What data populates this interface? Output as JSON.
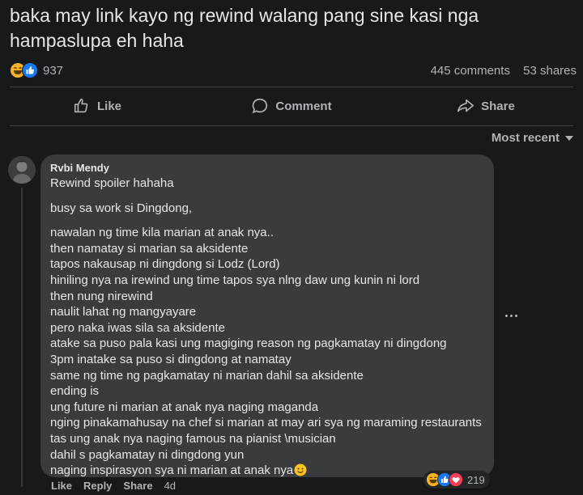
{
  "post": {
    "text": "baka may link kayo ng rewind walang pang sine kasi nga hampaslupa eh haha",
    "reaction_count": "937",
    "comments_count": "445 comments",
    "shares_count": "53 shares",
    "reaction_icons": [
      "haha-icon",
      "like-icon"
    ]
  },
  "actions": {
    "like": "Like",
    "comment": "Comment",
    "share": "Share"
  },
  "sort": {
    "label": "Most recent"
  },
  "comment": {
    "author": "Rvbi Mendy",
    "lines": [
      "Rewind spoiler hahaha",
      "busy sa work si Dingdong,",
      "nawalan ng time kila marian at anak nya..",
      "then namatay si marian sa aksidente",
      "tapos nakausap ni dingdong si Lodz (Lord)",
      "hiniling nya na irewind ung time tapos sya nlng daw ung kunin ni lord",
      "then nung nirewind",
      "naulit lahat ng mangyayare",
      "pero naka iwas sila sa aksidente",
      "atake sa puso pala kasi ung magiging reason ng pagkamatay ni dingdong",
      "3pm inatake sa puso si dingdong at namatay",
      "same ng time ng pagkamatay ni marian dahil sa aksidente",
      "ending is",
      "ung future ni marian at anak nya naging maganda",
      "nging pinakamahusay na chef si marian at may ari sya ng maraming restaurants",
      "tas ung anak nya naging famous na pianist \\musician",
      "dahil s pagkamatay ni dingdong yun",
      "naging inspirasyon sya ni marian at anak nya"
    ],
    "reaction_count": "219",
    "reaction_icons": [
      "haha-icon",
      "like-icon",
      "love-icon"
    ],
    "actions": {
      "like": "Like",
      "reply": "Reply",
      "share": "Share",
      "time": "4d"
    }
  },
  "colors": {
    "background": "#18191a",
    "bubble": "#3a3b3c",
    "text": "#e4e6eb",
    "muted": "#b0b3b8",
    "like_blue": "#1877f2",
    "haha_yellow": "#f7b125",
    "love_red": "#f33e58"
  }
}
